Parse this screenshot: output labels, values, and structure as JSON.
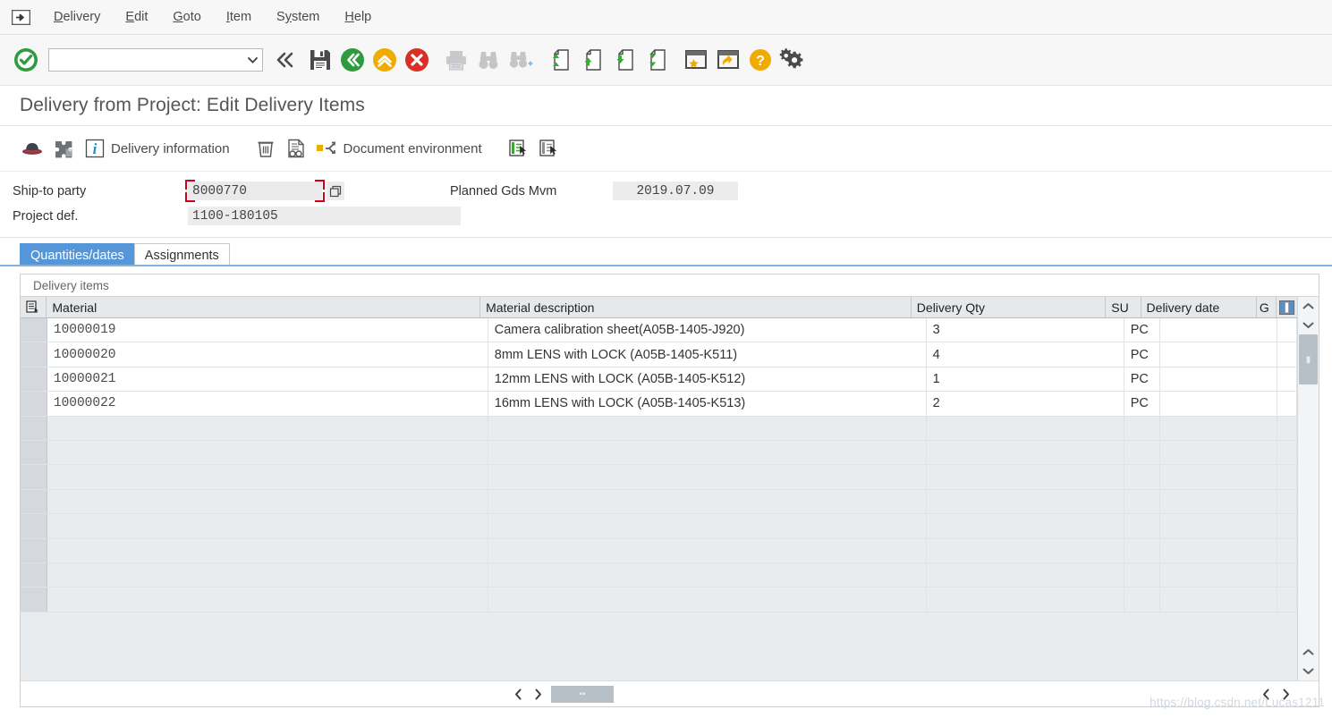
{
  "menubar": {
    "system_icon": "sap-system-menu-icon",
    "items": [
      {
        "label": "Delivery",
        "accel": "D"
      },
      {
        "label": "Edit",
        "accel": "E"
      },
      {
        "label": "Goto",
        "accel": "G"
      },
      {
        "label": "Item",
        "accel": "I"
      },
      {
        "label": "System",
        "accel": "y"
      },
      {
        "label": "Help",
        "accel": "H"
      }
    ]
  },
  "system_toolbar": {
    "enter_icon": "green-check-icon",
    "command_field": {
      "value": "",
      "placeholder": ""
    },
    "dropdown_icon": "chevron-down-icon",
    "buttons": [
      {
        "name": "collapse-command-icon",
        "icon": "double-chevron-left"
      },
      {
        "name": "save-icon",
        "icon": "floppy-disk"
      },
      {
        "name": "back-icon",
        "icon": "green-circle-left"
      },
      {
        "name": "exit-icon",
        "icon": "yellow-circle-up"
      },
      {
        "name": "cancel-icon",
        "icon": "red-circle-x"
      },
      {
        "name": "print-icon",
        "icon": "printer"
      },
      {
        "name": "find-icon",
        "icon": "binoculars"
      },
      {
        "name": "find-next-icon",
        "icon": "binoculars-plus"
      },
      {
        "name": "first-page-icon",
        "icon": "page-first"
      },
      {
        "name": "previous-page-icon",
        "icon": "page-up"
      },
      {
        "name": "next-page-icon",
        "icon": "page-down"
      },
      {
        "name": "last-page-icon",
        "icon": "page-last"
      },
      {
        "name": "create-session-icon",
        "icon": "window-star"
      },
      {
        "name": "create-shortcut-icon",
        "icon": "window-arrow"
      },
      {
        "name": "help-icon",
        "icon": "yellow-question"
      },
      {
        "name": "customize-local-layout-icon",
        "icon": "gear"
      }
    ]
  },
  "title": "Delivery from Project: Edit Delivery Items",
  "app_toolbar": {
    "buttons": [
      {
        "name": "hat-icon",
        "label": ""
      },
      {
        "name": "puzzle-icon",
        "label": ""
      },
      {
        "name": "delivery-information-button",
        "label": "Delivery information",
        "icon": "info-icon"
      },
      {
        "name": "delete-item-button",
        "label": "",
        "icon": "trash-icon"
      },
      {
        "name": "display-document-flow-button",
        "label": "",
        "icon": "document-search-icon"
      },
      {
        "name": "document-environment-button",
        "label": "Document environment",
        "icon": "environment-branch-icon"
      },
      {
        "name": "select-all-items-button",
        "label": "",
        "icon": "list-select-green-icon"
      },
      {
        "name": "deselect-all-items-button",
        "label": "",
        "icon": "list-select-grey-icon"
      }
    ]
  },
  "form": {
    "fields": [
      {
        "label": "Ship-to party",
        "value": "8000770",
        "focused": true,
        "has_f4": true
      },
      {
        "label": "Project def.",
        "value": "1100-180105",
        "focused": false,
        "has_f4": false
      },
      {
        "label": "Planned Gds Mvm",
        "value": "2019.07.09",
        "focused": false,
        "has_f4": false
      }
    ]
  },
  "tabs": [
    {
      "label": "Quantities/dates",
      "active": true
    },
    {
      "label": "Assignments",
      "active": false
    }
  ],
  "table": {
    "group_label": "Delivery items",
    "select_all_icon": "table-select-all-icon",
    "config_icon": "column-settings-icon",
    "columns": [
      {
        "key": "material",
        "label": "Material"
      },
      {
        "key": "description",
        "label": "Material description"
      },
      {
        "key": "qty",
        "label": "Delivery Qty"
      },
      {
        "key": "su",
        "label": "SU"
      },
      {
        "key": "date",
        "label": "Delivery date"
      },
      {
        "key": "g",
        "label": "G"
      }
    ],
    "rows": [
      {
        "material": "10000019",
        "description": "Camera calibration sheet(A05B-1405-J920)",
        "qty": "3",
        "su": "PC",
        "date": "",
        "g": ""
      },
      {
        "material": "10000020",
        "description": "8mm LENS with LOCK (A05B-1405-K511)",
        "qty": "4",
        "su": "PC",
        "date": "",
        "g": ""
      },
      {
        "material": "10000021",
        "description": "12mm LENS with LOCK (A05B-1405-K512)",
        "qty": "1",
        "su": "PC",
        "date": "",
        "g": ""
      },
      {
        "material": "10000022",
        "description": "16mm LENS with LOCK (A05B-1405-K513)",
        "qty": "2",
        "su": "PC",
        "date": "",
        "g": ""
      }
    ],
    "empty_row_count": 8
  },
  "scrollbars": {
    "vertical_up_icon": "chevron-up-icon",
    "vertical_down_icon": "chevron-down-icon",
    "horizontal_left_icon": "chevron-left-icon",
    "horizontal_right_icon": "chevron-right-icon"
  },
  "watermark": "https://blog.csdn.net/Lucas1211",
  "colors": {
    "accent_blue": "#5596d8",
    "toolbar_bg": "#f7f7f7",
    "grid_empty_row": "#e8ecef",
    "focus_bracket_red": "#d0021b",
    "green": "#2e9b3f",
    "yellow": "#f0ab00",
    "red": "#d93025"
  }
}
